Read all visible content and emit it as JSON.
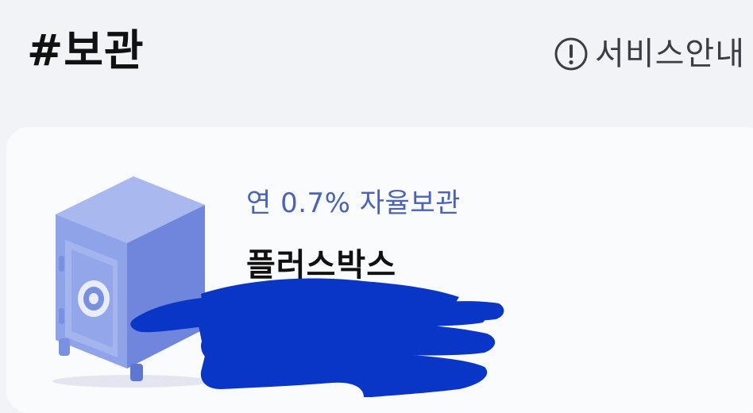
{
  "header": {
    "title": "#보관",
    "service_info": {
      "label": "서비스안내",
      "icon": "exclamation-circle-icon"
    }
  },
  "card": {
    "illustration": "safe-icon",
    "subtitle": "연 0.7% 자율보관",
    "name": "플러스박스",
    "redaction_color": "#0a36c8"
  },
  "colors": {
    "background": "#f1f3f6",
    "card": "#fafbfc",
    "accent": "#4a63b8",
    "safe": "#8ea3e8"
  }
}
